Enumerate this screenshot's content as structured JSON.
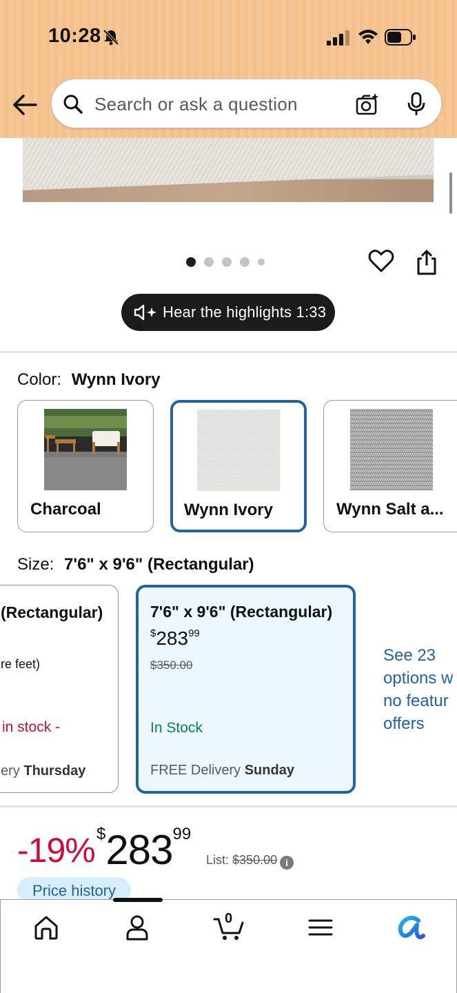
{
  "status_bar": {
    "time": "10:28"
  },
  "search": {
    "placeholder": "Search or ask a question"
  },
  "carousel": {
    "dot_count": 5,
    "active_index": 0
  },
  "audio": {
    "label": "Hear the highlights 1:33"
  },
  "color": {
    "label": "Color:",
    "selected": "Wynn Ivory",
    "options": [
      {
        "name": "Charcoal"
      },
      {
        "name": "Wynn Ivory"
      },
      {
        "name": "Wynn Salt a..."
      }
    ]
  },
  "size": {
    "label": "Size:",
    "selected": "7'6\" x 9'6\" (Rectangular)",
    "left_card": {
      "title": "(Rectangular)",
      "subtitle": "re feet)",
      "stock": "in stock -",
      "delivery_prefix": "ery",
      "delivery_day": "Thursday"
    },
    "selected_card": {
      "title": "7'6\" x 9'6\" (Rectangular)",
      "price_symbol": "$",
      "price_whole": "283",
      "price_fraction": "99",
      "list_price": "$350.00",
      "stock": "In Stock",
      "delivery_prefix": "FREE Delivery",
      "delivery_day": "Sunday"
    },
    "see_options": [
      "See 23",
      "options w",
      "no featur",
      "offers"
    ]
  },
  "price": {
    "discount": "-19%",
    "currency": "$",
    "whole": "283",
    "fraction": "99",
    "list_label": "List:",
    "list_value": "$350.00",
    "history_label": "Price history"
  },
  "nav": {
    "cart_count": "0"
  },
  "colors": {
    "header_bg": "#f6c694",
    "selected_border": "#2162a1",
    "discount_red": "#cc0c39",
    "in_stock_green": "#067d62",
    "link_blue": "#2162a1"
  }
}
